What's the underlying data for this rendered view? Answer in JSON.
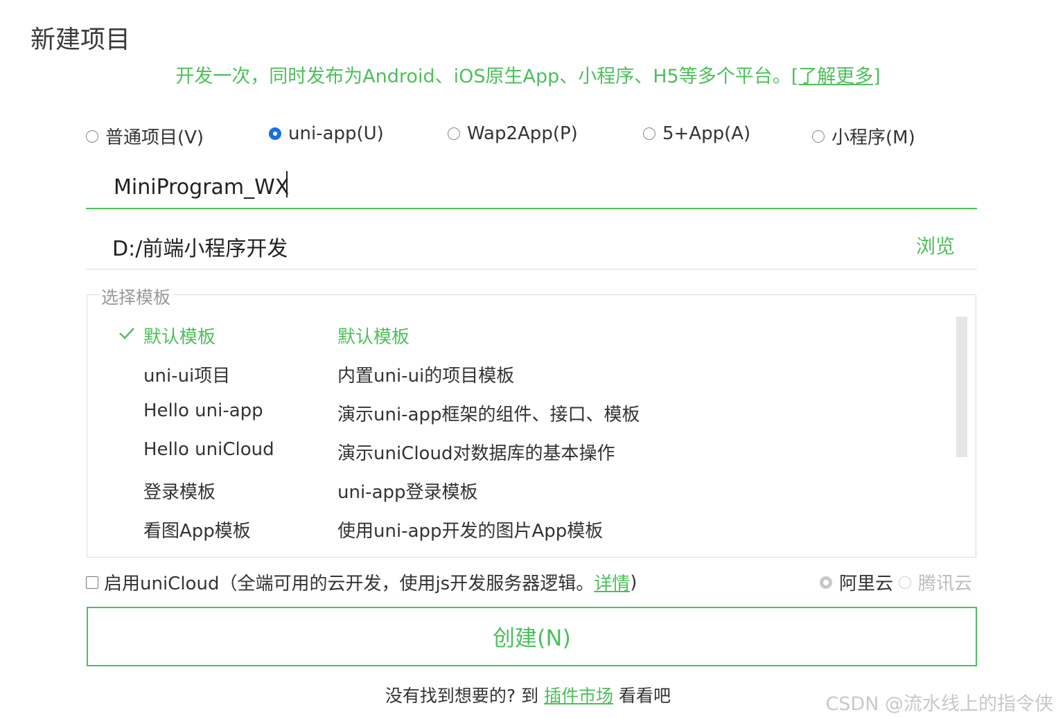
{
  "dialog": {
    "title": "新建项目",
    "subtitle": "开发一次，同时发布为Android、iOS原生App、小程序、H5等多个平台。",
    "learn_more": "[了解更多]"
  },
  "project_types": [
    {
      "label": "普通项目(V)",
      "selected": false
    },
    {
      "label": "uni-app(U)",
      "selected": true
    },
    {
      "label": "Wap2App(P)",
      "selected": false
    },
    {
      "label": "5+App(A)",
      "selected": false
    },
    {
      "label": "小程序(M)",
      "selected": false
    }
  ],
  "project_name": {
    "value": "MiniProgram_WX"
  },
  "location": {
    "path": "D:/前端小程序开发",
    "browse_label": "浏览"
  },
  "templates": {
    "legend": "选择模板",
    "items": [
      {
        "name": "默认模板",
        "desc": "默认模板",
        "selected": true
      },
      {
        "name": "uni-ui项目",
        "desc": "内置uni-ui的项目模板",
        "selected": false
      },
      {
        "name": "Hello uni-app",
        "desc": "演示uni-app框架的组件、接口、模板",
        "selected": false
      },
      {
        "name": "Hello uniCloud",
        "desc": "演示uniCloud对数据库的基本操作",
        "selected": false
      },
      {
        "name": "登录模板",
        "desc": "uni-app登录模板",
        "selected": false
      },
      {
        "name": "看图App模板",
        "desc": "使用uni-app开发的图片App模板",
        "selected": false
      }
    ]
  },
  "unicloud": {
    "label": "启用uniCloud（全端可用的云开发，使用js开发服务器逻辑。",
    "details": "详情",
    "close_paren": ")",
    "enabled": false,
    "providers": [
      {
        "label": "阿里云",
        "selected": true
      },
      {
        "label": "腾讯云",
        "selected": false
      }
    ]
  },
  "create_button": "创建(N)",
  "footer": {
    "prefix": "没有找到想要的? 到 ",
    "link": "插件市场",
    "suffix": " 看看吧"
  },
  "watermark": "CSDN @流水线上的指令侠",
  "colors": {
    "accent": "#4cc05a",
    "radio_selected": "#1a6fe0"
  }
}
